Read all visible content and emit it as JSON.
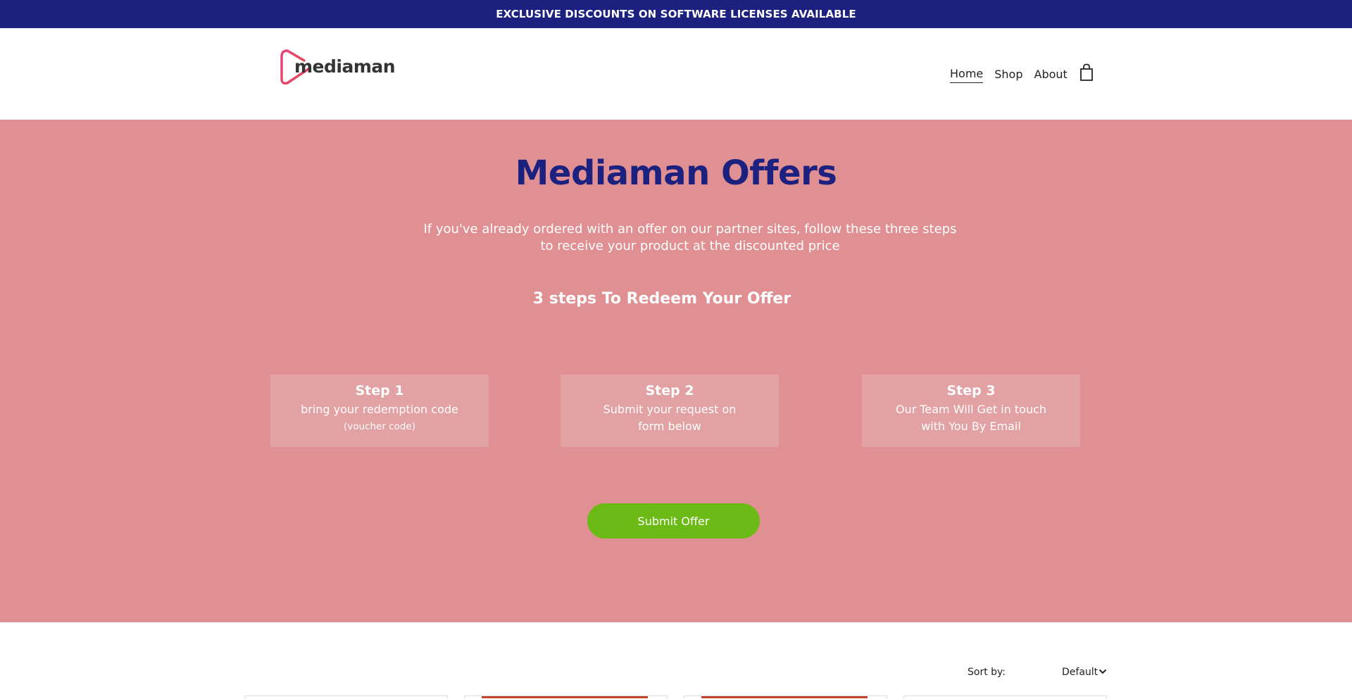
{
  "announcement": "EXCLUSIVE DISCOUNTS ON SOFTWARE LICENSES AVAILABLE",
  "brand": {
    "name": "mediaman",
    "accent": "#e5466b"
  },
  "nav": {
    "items": [
      "Home",
      "Shop",
      "About"
    ],
    "active": "Home",
    "cart_icon": "shopping-bag-icon"
  },
  "hero": {
    "background": "#e09092",
    "title": "Mediaman Offers",
    "subtitle": "If you've already ordered with an offer on our partner sites, follow these three steps to receive your product at the discounted price",
    "steps_heading": "3 steps To Redeem Your Offer",
    "steps": [
      {
        "title": "Step 1",
        "line1": "bring your redemption code",
        "line2": "",
        "note": "(voucher code)"
      },
      {
        "title": "Step 2",
        "line1": "Submit your request on",
        "line2": "form below",
        "note": ""
      },
      {
        "title": "Step 3",
        "line1": "Our Team Will Get in touch",
        "line2": "with You By Email",
        "note": ""
      }
    ],
    "button_label": "Submit Offer",
    "button_color": "#6cba16"
  },
  "shop": {
    "sort_label": "Sort by:",
    "sort_value": "Default"
  },
  "colors": {
    "announcement_bg": "#1c2180",
    "title": "#1c2180"
  }
}
